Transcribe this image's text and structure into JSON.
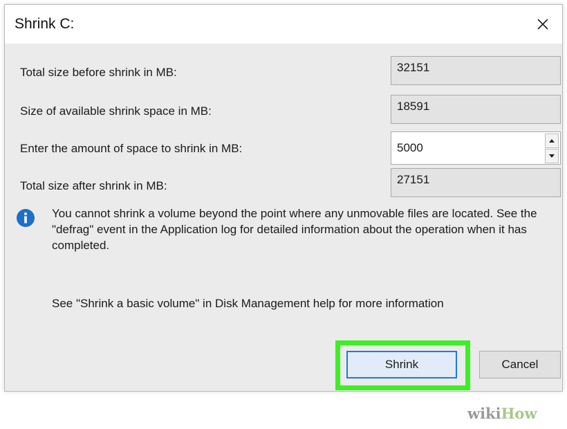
{
  "dialog": {
    "title": "Shrink C:",
    "close_symbol": "✕",
    "close_icon": "close-icon"
  },
  "fields": [
    {
      "label": "Total size before shrink in MB:",
      "value": "32151"
    },
    {
      "label": "Size of available shrink space in MB:",
      "value": "18591"
    },
    {
      "label": "Enter the amount of space to shrink in MB:",
      "value": "5000"
    },
    {
      "label": "Total size after shrink in MB:",
      "value": "27151"
    }
  ],
  "info": {
    "icon": "info-icon",
    "text": "You cannot shrink a volume beyond the point where any unmovable files are located. See the \"defrag\" event in the Application log for detailed information about the operation when it has completed."
  },
  "help_text": "See \"Shrink a basic volume\" in Disk Management help for more information",
  "buttons": {
    "shrink": "Shrink",
    "cancel": "Cancel"
  },
  "colors": {
    "highlight": "#3df023",
    "info_icon": "#1e6fc6",
    "button_focus_border": "#1e7ad6"
  },
  "watermark": {
    "part1": "wiki",
    "part2": "How"
  }
}
